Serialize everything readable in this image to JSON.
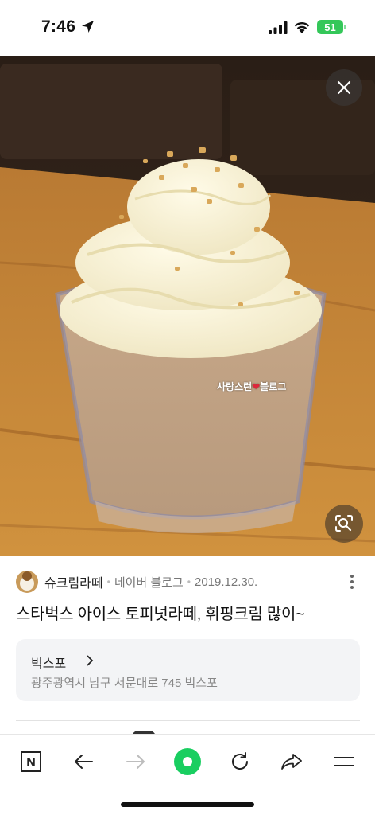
{
  "status_bar": {
    "time": "7:46",
    "battery": "51"
  },
  "photo": {
    "watermark_text": "사랑스런",
    "watermark_suffix": "블로그"
  },
  "post": {
    "author": "슈크림라떼",
    "source": "네이버 블로그",
    "date": "2019.12.30.",
    "title": "스타벅스 아이스 토피넛라떼, 휘핑크림 많이~"
  },
  "place": {
    "name": "빅스포",
    "address": "광주광역시 남구 서문대로 745 빅스포"
  },
  "toolbar": {
    "naver_label": "N",
    "accent_color": "#19ce60"
  }
}
